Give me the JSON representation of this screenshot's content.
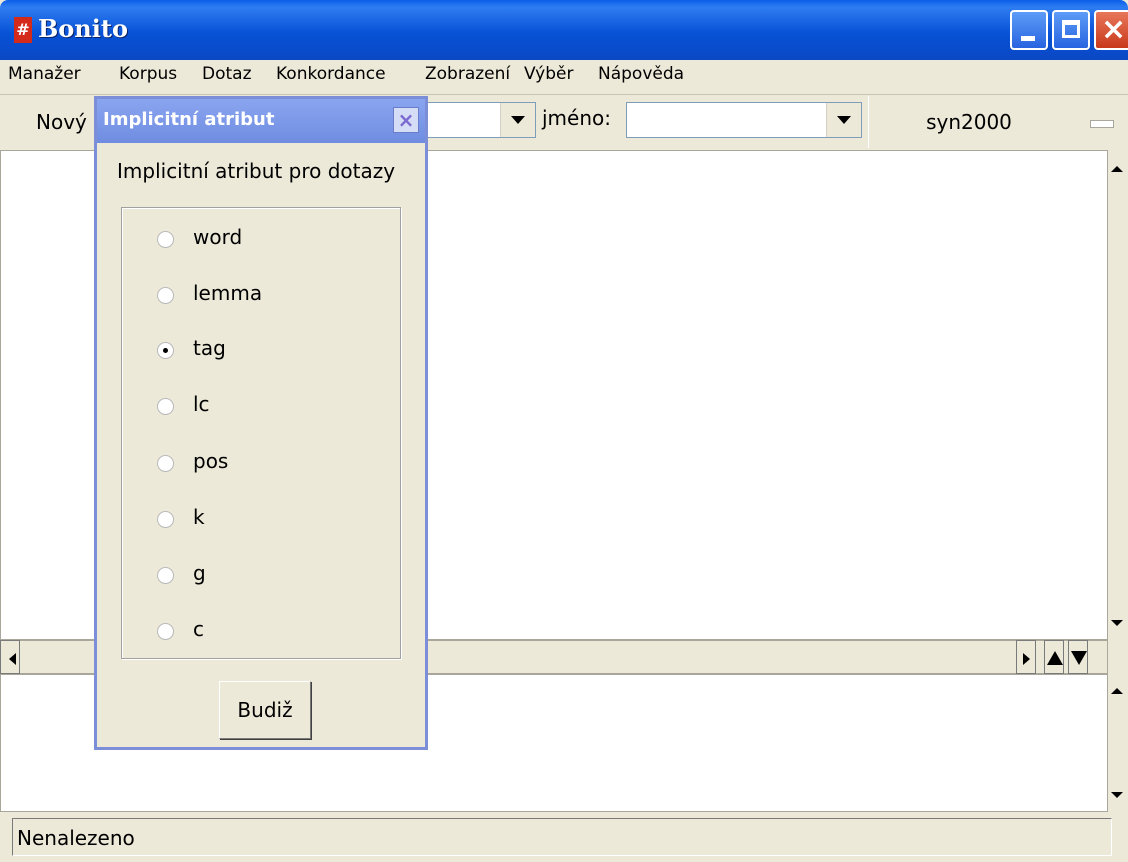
{
  "window": {
    "title": "Bonito"
  },
  "menu": [
    "Manažer",
    "Korpus",
    "Dotaz",
    "Konkordance",
    "Zobrazení",
    "Výběr",
    "Nápověda"
  ],
  "toolbar": {
    "new_label": "Nový",
    "name_label": "jméno:",
    "name_value": "",
    "corpus_label": "syn2000"
  },
  "dialog": {
    "title": "Implicitní atribut",
    "heading": "Implicitní atribut pro dotazy",
    "options": [
      "word",
      "lemma",
      "tag",
      "lc",
      "pos",
      "k",
      "g",
      "c"
    ],
    "selected": "tag",
    "ok_label": "Budiž"
  },
  "status": {
    "text": "Nenalezeno"
  }
}
